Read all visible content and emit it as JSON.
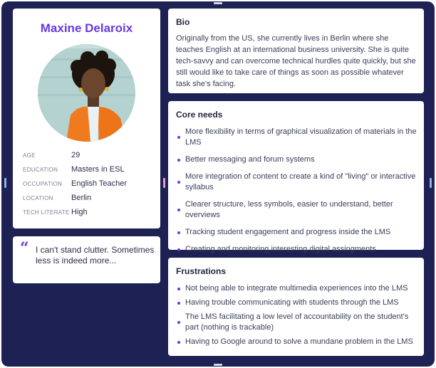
{
  "persona": {
    "name": "Maxine Delaroix",
    "details": [
      {
        "label": "AGE",
        "value": "29"
      },
      {
        "label": "EDUCATION",
        "value": "Masters in ESL"
      },
      {
        "label": "OCCUPATION",
        "value": "English Teacher"
      },
      {
        "label": "LOCATION",
        "value": "Berlin"
      },
      {
        "label": "TECH LITERATE",
        "value": "High"
      }
    ],
    "quote": "I can't stand clutter. Sometimes less is indeed more..."
  },
  "bio": {
    "title": "Bio",
    "text": "Originally from the US, she currently lives in Berlin where she teaches English at an international business university. She is quite tech-savvy and can overcome technical hurdles quite quickly, but she still would like to take care of things as soon as possible whatever task she's facing."
  },
  "core_needs": {
    "title": "Core needs",
    "items": [
      "More flexibility in terms of graphical visualization of materials in the LMS",
      "Better messaging and forum systems",
      "More integration of content to create a kind of \"living\" or interactive syllabus",
      "Clearer structure, less symbols, easier to understand, better overviews",
      "Tracking student engagement and progress inside the LMS",
      "Creating and monitoring interesting digital assingments"
    ]
  },
  "frustrations": {
    "title": "Frustrations",
    "items": [
      "Not  being able to integrate multimedia experiences into the LMS",
      "Having trouble communicating with students through the LMS",
      "The LMS facilitating a low level of accountability on the student's part (nothing is trackable)",
      "Having to Google around to solve a mundane problem in the LMS"
    ]
  },
  "colors": {
    "background": "#1e2153",
    "accent": "#6a38e0",
    "card": "#ffffff"
  },
  "icons": [
    "quote-icon",
    "avatar-photo"
  ]
}
